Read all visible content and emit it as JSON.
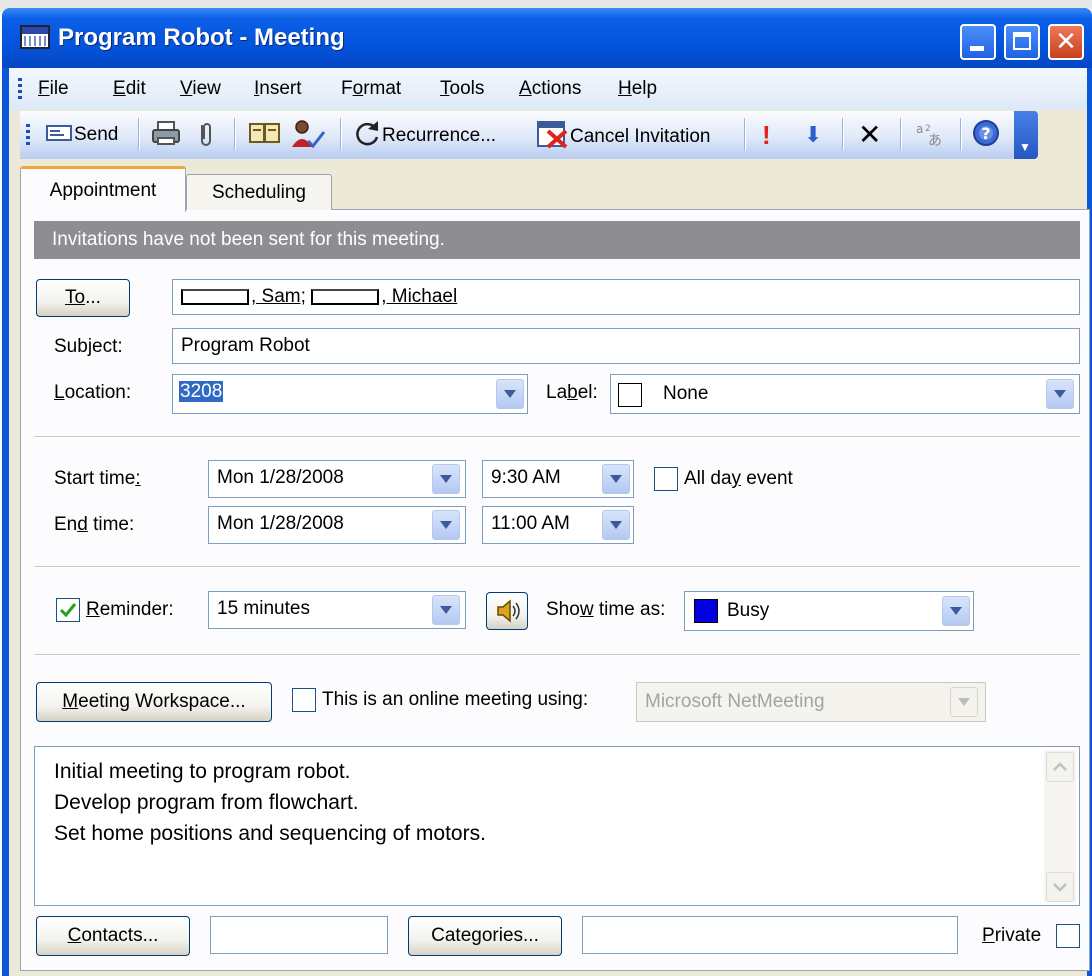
{
  "window": {
    "title": "Program Robot - Meeting",
    "minimize_glyph": "_",
    "maximize_glyph": "□",
    "close_glyph": "✕"
  },
  "menubar": {
    "items": [
      {
        "label": "File",
        "underline": "F",
        "rest": "ile"
      },
      {
        "label": "Edit",
        "underline": "E",
        "rest": "dit"
      },
      {
        "label": "View",
        "underline": "V",
        "rest": "iew"
      },
      {
        "label": "Insert",
        "underline": "I",
        "rest": "nsert"
      },
      {
        "label": "Format",
        "underline_pre": "F",
        "underline": "o",
        "rest": "rmat"
      },
      {
        "label": "Tools",
        "underline": "T",
        "rest": "ools"
      },
      {
        "label": "Actions",
        "underline": "A",
        "rest": "ctions"
      },
      {
        "label": "Help",
        "underline": "H",
        "rest": "elp"
      }
    ]
  },
  "toolbar": {
    "send_label": "Send",
    "recurrence_label": "Recurrence...",
    "cancel_invitation_label": "Cancel Invitation",
    "importance_high_glyph": "!",
    "importance_low_glyph": "⬇",
    "delete_glyph": "✕",
    "help_glyph": "?",
    "icons": [
      "send-icon",
      "print-icon",
      "attach-icon",
      "address-book-icon",
      "check-names-icon",
      "recurrence-icon",
      "cancel-invitation-icon",
      "importance-high-icon",
      "importance-low-icon",
      "delete-icon",
      "translate-icon",
      "help-icon"
    ]
  },
  "tabs": [
    {
      "label": "Appointment",
      "active": true
    },
    {
      "label": "Scheduling",
      "active": false
    }
  ],
  "info_bar": "Invitations have not been sent for this meeting.",
  "form": {
    "to_button": "To...",
    "to_recipients": [
      ", Sam;",
      ", Michael"
    ],
    "subject_label": "Subject:",
    "subject_value": "Program Robot",
    "location_label": "Location:",
    "location_value": "3208",
    "label_label": "Label:",
    "label_value": "None",
    "start_time_label": "Start time:",
    "start_date": "Mon 1/28/2008",
    "start_time": "9:30 AM",
    "all_day_label": "All day event",
    "all_day_checked": false,
    "end_time_label": "End time:",
    "end_date": "Mon 1/28/2008",
    "end_time": "11:00 AM",
    "reminder_label": "Reminder:",
    "reminder_checked": true,
    "reminder_value": "15 minutes",
    "show_time_as_label": "Show time as:",
    "show_time_as_value": "Busy",
    "busy_color": "#0000e0",
    "meeting_workspace_button": "Meeting Workspace...",
    "online_meeting_label": "This is an online meeting using:",
    "online_meeting_checked": false,
    "online_meeting_value": "Microsoft NetMeeting",
    "notes": [
      "Initial meeting to program robot.",
      "Develop program from flowchart.",
      "Set home positions and sequencing of motors."
    ],
    "contacts_button": "Contacts...",
    "categories_button": "Categories...",
    "private_label": "Private",
    "private_checked": false
  }
}
